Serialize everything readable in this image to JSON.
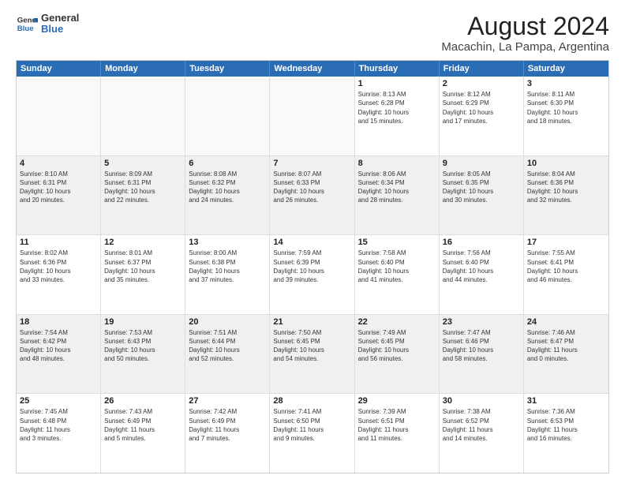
{
  "header": {
    "logo_line1": "General",
    "logo_line2": "Blue",
    "title": "August 2024",
    "subtitle": "Macachin, La Pampa, Argentina"
  },
  "weekdays": [
    "Sunday",
    "Monday",
    "Tuesday",
    "Wednesday",
    "Thursday",
    "Friday",
    "Saturday"
  ],
  "rows": [
    [
      {
        "day": "",
        "info": ""
      },
      {
        "day": "",
        "info": ""
      },
      {
        "day": "",
        "info": ""
      },
      {
        "day": "",
        "info": ""
      },
      {
        "day": "1",
        "info": "Sunrise: 8:13 AM\nSunset: 6:28 PM\nDaylight: 10 hours\nand 15 minutes."
      },
      {
        "day": "2",
        "info": "Sunrise: 8:12 AM\nSunset: 6:29 PM\nDaylight: 10 hours\nand 17 minutes."
      },
      {
        "day": "3",
        "info": "Sunrise: 8:11 AM\nSunset: 6:30 PM\nDaylight: 10 hours\nand 18 minutes."
      }
    ],
    [
      {
        "day": "4",
        "info": "Sunrise: 8:10 AM\nSunset: 6:31 PM\nDaylight: 10 hours\nand 20 minutes."
      },
      {
        "day": "5",
        "info": "Sunrise: 8:09 AM\nSunset: 6:31 PM\nDaylight: 10 hours\nand 22 minutes."
      },
      {
        "day": "6",
        "info": "Sunrise: 8:08 AM\nSunset: 6:32 PM\nDaylight: 10 hours\nand 24 minutes."
      },
      {
        "day": "7",
        "info": "Sunrise: 8:07 AM\nSunset: 6:33 PM\nDaylight: 10 hours\nand 26 minutes."
      },
      {
        "day": "8",
        "info": "Sunrise: 8:06 AM\nSunset: 6:34 PM\nDaylight: 10 hours\nand 28 minutes."
      },
      {
        "day": "9",
        "info": "Sunrise: 8:05 AM\nSunset: 6:35 PM\nDaylight: 10 hours\nand 30 minutes."
      },
      {
        "day": "10",
        "info": "Sunrise: 8:04 AM\nSunset: 6:36 PM\nDaylight: 10 hours\nand 32 minutes."
      }
    ],
    [
      {
        "day": "11",
        "info": "Sunrise: 8:02 AM\nSunset: 6:36 PM\nDaylight: 10 hours\nand 33 minutes."
      },
      {
        "day": "12",
        "info": "Sunrise: 8:01 AM\nSunset: 6:37 PM\nDaylight: 10 hours\nand 35 minutes."
      },
      {
        "day": "13",
        "info": "Sunrise: 8:00 AM\nSunset: 6:38 PM\nDaylight: 10 hours\nand 37 minutes."
      },
      {
        "day": "14",
        "info": "Sunrise: 7:59 AM\nSunset: 6:39 PM\nDaylight: 10 hours\nand 39 minutes."
      },
      {
        "day": "15",
        "info": "Sunrise: 7:58 AM\nSunset: 6:40 PM\nDaylight: 10 hours\nand 41 minutes."
      },
      {
        "day": "16",
        "info": "Sunrise: 7:56 AM\nSunset: 6:40 PM\nDaylight: 10 hours\nand 44 minutes."
      },
      {
        "day": "17",
        "info": "Sunrise: 7:55 AM\nSunset: 6:41 PM\nDaylight: 10 hours\nand 46 minutes."
      }
    ],
    [
      {
        "day": "18",
        "info": "Sunrise: 7:54 AM\nSunset: 6:42 PM\nDaylight: 10 hours\nand 48 minutes."
      },
      {
        "day": "19",
        "info": "Sunrise: 7:53 AM\nSunset: 6:43 PM\nDaylight: 10 hours\nand 50 minutes."
      },
      {
        "day": "20",
        "info": "Sunrise: 7:51 AM\nSunset: 6:44 PM\nDaylight: 10 hours\nand 52 minutes."
      },
      {
        "day": "21",
        "info": "Sunrise: 7:50 AM\nSunset: 6:45 PM\nDaylight: 10 hours\nand 54 minutes."
      },
      {
        "day": "22",
        "info": "Sunrise: 7:49 AM\nSunset: 6:45 PM\nDaylight: 10 hours\nand 56 minutes."
      },
      {
        "day": "23",
        "info": "Sunrise: 7:47 AM\nSunset: 6:46 PM\nDaylight: 10 hours\nand 58 minutes."
      },
      {
        "day": "24",
        "info": "Sunrise: 7:46 AM\nSunset: 6:47 PM\nDaylight: 11 hours\nand 0 minutes."
      }
    ],
    [
      {
        "day": "25",
        "info": "Sunrise: 7:45 AM\nSunset: 6:48 PM\nDaylight: 11 hours\nand 3 minutes."
      },
      {
        "day": "26",
        "info": "Sunrise: 7:43 AM\nSunset: 6:49 PM\nDaylight: 11 hours\nand 5 minutes."
      },
      {
        "day": "27",
        "info": "Sunrise: 7:42 AM\nSunset: 6:49 PM\nDaylight: 11 hours\nand 7 minutes."
      },
      {
        "day": "28",
        "info": "Sunrise: 7:41 AM\nSunset: 6:50 PM\nDaylight: 11 hours\nand 9 minutes."
      },
      {
        "day": "29",
        "info": "Sunrise: 7:39 AM\nSunset: 6:51 PM\nDaylight: 11 hours\nand 11 minutes."
      },
      {
        "day": "30",
        "info": "Sunrise: 7:38 AM\nSunset: 6:52 PM\nDaylight: 11 hours\nand 14 minutes."
      },
      {
        "day": "31",
        "info": "Sunrise: 7:36 AM\nSunset: 6:53 PM\nDaylight: 11 hours\nand 16 minutes."
      }
    ]
  ]
}
